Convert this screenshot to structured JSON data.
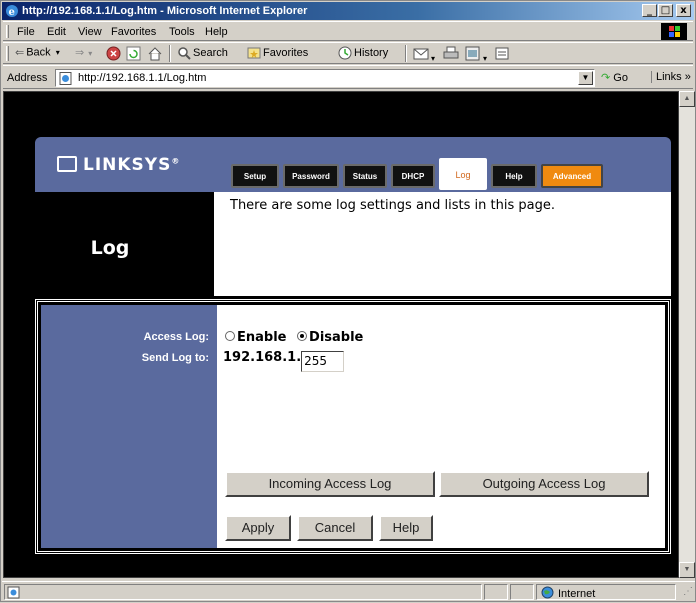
{
  "window": {
    "title": "http://192.168.1.1/Log.htm - Microsoft Internet Explorer",
    "minimize": "_",
    "maximize": "□",
    "close": "x"
  },
  "menu": [
    "File",
    "Edit",
    "View",
    "Favorites",
    "Tools",
    "Help"
  ],
  "toolbar": {
    "back": "Back",
    "search": "Search",
    "favorites": "Favorites",
    "history": "History"
  },
  "address": {
    "label": "Address",
    "url": "http://192.168.1.1/Log.htm",
    "go": "Go",
    "links": "Links »"
  },
  "linksys": {
    "logo": "LINKSYS",
    "tabs": [
      "Setup",
      "Password",
      "Status",
      "DHCP",
      "Log",
      "Help",
      "Advanced"
    ],
    "active_tab": "Log",
    "page_title": "Log",
    "description": "There are some log settings and lists in this page.",
    "access_log_label": "Access Log:",
    "send_log_label": "Send Log to:",
    "enable_label": "Enable",
    "disable_label": "Disable",
    "access_log_value": "Disable",
    "ip_prefix": "192.168.1.",
    "ip_last_octet": "255",
    "incoming_button": "Incoming Access Log",
    "outgoing_button": "Outgoing Access Log",
    "apply_button": "Apply",
    "cancel_button": "Cancel",
    "help_button": "Help"
  },
  "status": {
    "zone": "Internet"
  },
  "colors": {
    "linksys_blue": "#5a6a9e",
    "tab_active_text": "#d2691e",
    "advanced_tab": "#f08a10"
  }
}
